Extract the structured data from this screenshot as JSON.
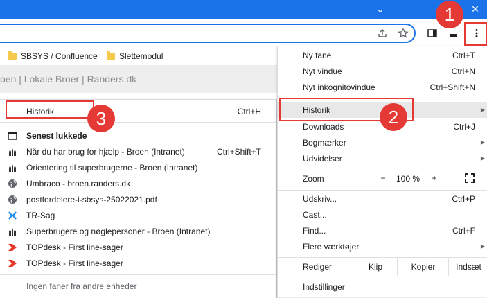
{
  "titlebar": {
    "minimize": "⌄",
    "close": "✕"
  },
  "bookmarks": [
    {
      "label": "SBSYS / Confluence"
    },
    {
      "label": "Slettemodul"
    }
  ],
  "page": {
    "breadcrumb": "oen  |  Lokale Broer  |  Randers.dk"
  },
  "main_menu": {
    "items": [
      {
        "label": "Ny fane",
        "shortcut": "Ctrl+T"
      },
      {
        "label": "Nyt vindue",
        "shortcut": "Ctrl+N"
      },
      {
        "label": "Nyt inkognitovindue",
        "shortcut": "Ctrl+Shift+N"
      },
      {
        "label": "Historik",
        "shortcut": ""
      },
      {
        "label": "Downloads",
        "shortcut": "Ctrl+J"
      },
      {
        "label": "Bogmærker",
        "shortcut": ""
      },
      {
        "label": "Udvidelser",
        "shortcut": ""
      },
      {
        "label": "Udskriv...",
        "shortcut": "Ctrl+P"
      },
      {
        "label": "Cast...",
        "shortcut": ""
      },
      {
        "label": "Find...",
        "shortcut": "Ctrl+F"
      },
      {
        "label": "Flere værktøjer",
        "shortcut": ""
      },
      {
        "label": "Indstillinger",
        "shortcut": ""
      }
    ],
    "zoom": {
      "label": "Zoom",
      "minus": "−",
      "value": "100 %",
      "plus": "+"
    },
    "edit": {
      "label": "Rediger",
      "cut": "Klip",
      "copy": "Kopier",
      "paste": "Indsæt"
    }
  },
  "history_submenu": {
    "history": {
      "label": "Historik",
      "shortcut": "Ctrl+H"
    },
    "recently_closed": "Senest lukkede",
    "items": [
      {
        "label": "Når du har brug for hjælp - Broen (Intranet)",
        "shortcut": "Ctrl+Shift+T",
        "icon": "broen-icon"
      },
      {
        "label": "Orientering til superbrugerne - Broen (Intranet)",
        "shortcut": "",
        "icon": "broen-icon"
      },
      {
        "label": "Umbraco - broen.randers.dk",
        "shortcut": "",
        "icon": "globe-icon"
      },
      {
        "label": "postfordelere-i-sbsys-25022021.pdf",
        "shortcut": "",
        "icon": "globe-icon"
      },
      {
        "label": "TR-Sag",
        "shortcut": "",
        "icon": "tr-sag-icon"
      },
      {
        "label": "Superbrugere og nøglepersoner - Broen (Intranet)",
        "shortcut": "",
        "icon": "broen-icon"
      },
      {
        "label": "TOPdesk - First line-sager",
        "shortcut": "",
        "icon": "topdesk-icon"
      },
      {
        "label": "TOPdesk - First line-sager",
        "shortcut": "",
        "icon": "topdesk-icon"
      }
    ],
    "other_devices": "Ingen faner fra andre enheder"
  },
  "callouts": [
    "1",
    "2",
    "3"
  ],
  "colors": {
    "accent": "#1a73e8",
    "callout": "#e53935",
    "topdesk": "#e8392b",
    "tr_sag": "#1e88e5"
  }
}
